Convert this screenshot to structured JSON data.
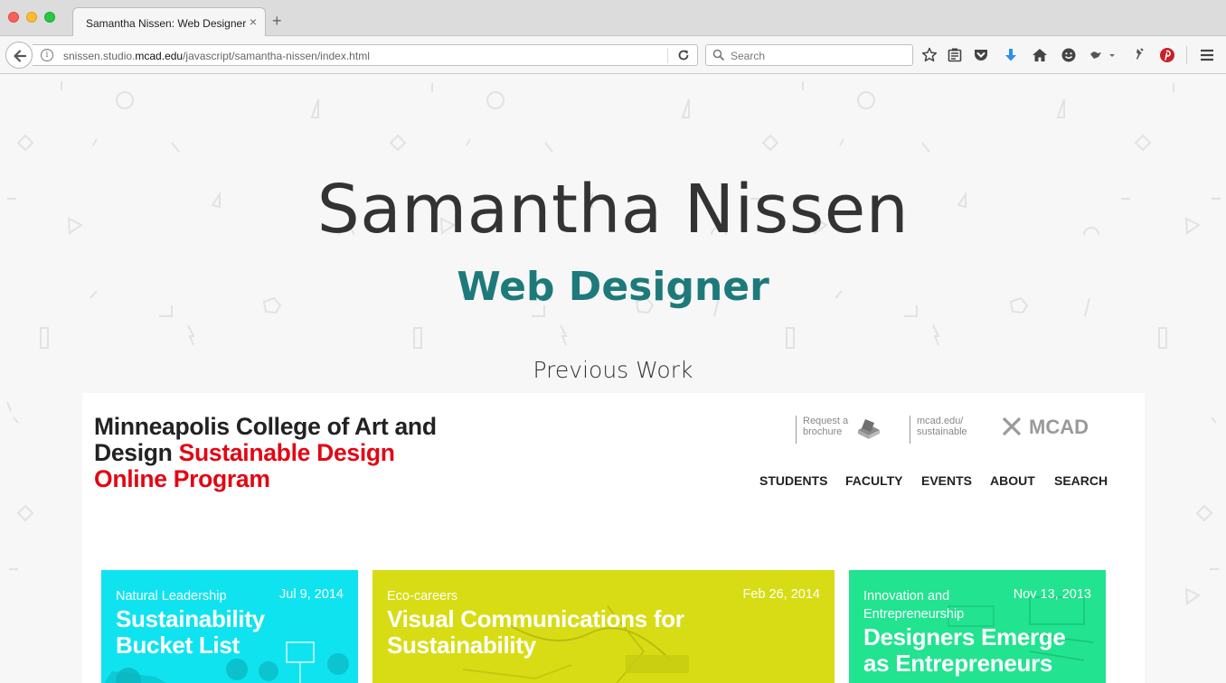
{
  "browser": {
    "tab_title": "Samantha Nissen: Web Designer",
    "tab_close": "×",
    "new_tab": "+",
    "url_prefix": "snissen.studio.",
    "url_domain": "mcad.edu",
    "url_path": "/javascript/samantha-nissen/index.html",
    "search_placeholder": "Search",
    "info_glyph": "i",
    "toolbar_icons": [
      "star-icon",
      "reading-list-icon",
      "pocket-icon",
      "download-icon",
      "home-icon",
      "smiley-icon",
      "extension-icon",
      "pin-icon",
      "pinterest-icon",
      "menu-icon"
    ],
    "accent_colors": {
      "download": "#2a90e8",
      "pinterest": "#cb2027"
    }
  },
  "hero": {
    "name": "Samantha Nissen",
    "role": "Web Designer",
    "section_label": "Previous Work",
    "colors": {
      "name": "#333333",
      "role": "#1e7a7a"
    }
  },
  "preview": {
    "title_dark": "Minneapolis College of Art and Design ",
    "title_red": "Sustainable Design Online Program",
    "brochure_line1": "Request a",
    "brochure_line2": "brochure",
    "link_line1": "mcad.edu/",
    "link_line2": "sustainable",
    "logo_text": "MCAD",
    "nav": [
      "STUDENTS",
      "FACULTY",
      "EVENTS",
      "ABOUT",
      "SEARCH"
    ],
    "cards": [
      {
        "category": "Natural Leadership",
        "date": "Jul 9, 2014",
        "title_line1": "Sustainability",
        "title_line2": "Bucket List",
        "color": "#0fe3f0"
      },
      {
        "category": "Eco-careers",
        "date": "Feb 26, 2014",
        "title_line1": "Visual Communications for",
        "title_line2": "Sustainability",
        "color": "#d8dc14"
      },
      {
        "category_line1": "Innovation and",
        "category_line2": "Entrepreneurship",
        "date": "Nov 13, 2013",
        "title_line1": "Designers Emerge",
        "title_line2": "as Entrepreneurs",
        "color": "#22e38f"
      }
    ],
    "title_red_color": "#e30613"
  }
}
